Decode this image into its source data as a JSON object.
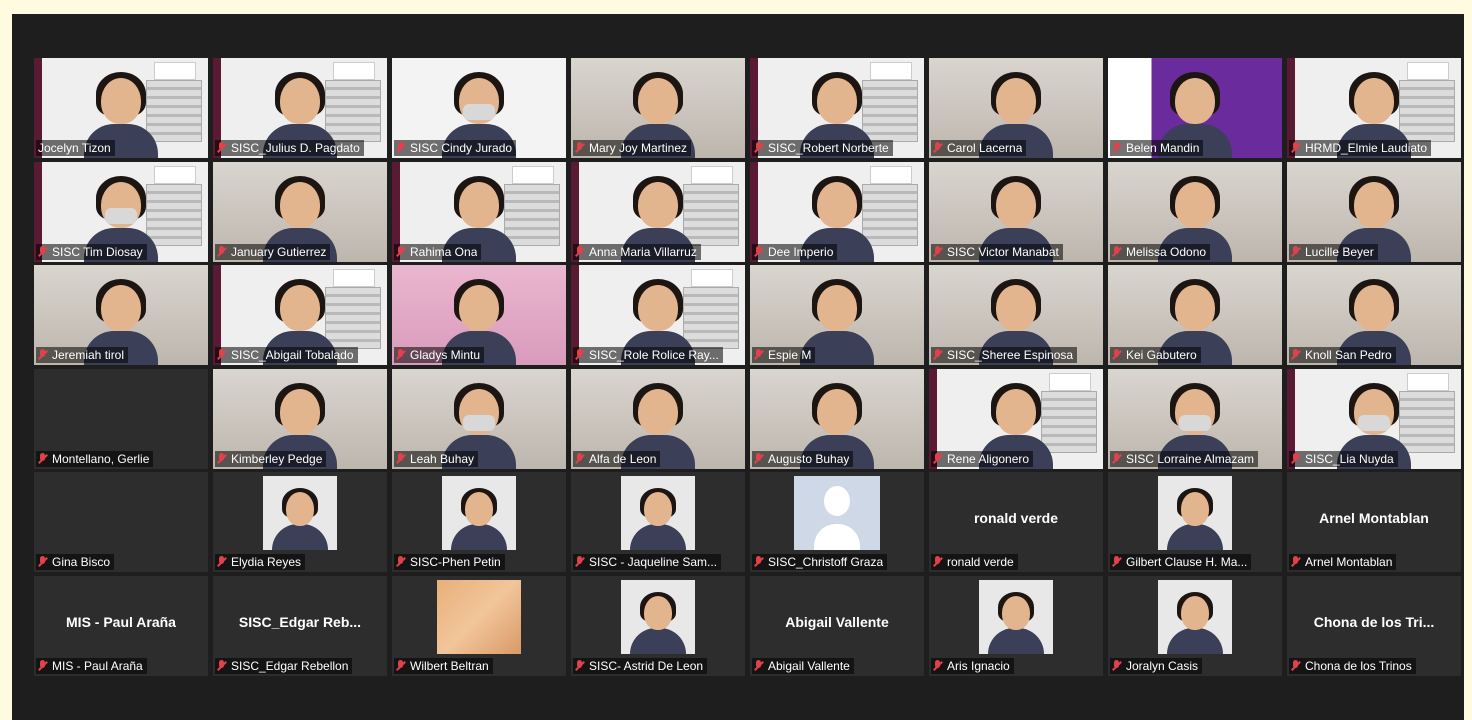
{
  "meeting": {
    "participants": [
      {
        "name": "Jocelyn Tizon",
        "muted": false,
        "bg": "branded",
        "view": "video"
      },
      {
        "name": "SISC_Julius D. Pagdato",
        "muted": true,
        "bg": "branded",
        "view": "video"
      },
      {
        "name": "SISC Cindy Jurado",
        "muted": true,
        "bg": "white",
        "view": "video",
        "mask": true
      },
      {
        "name": "Mary Joy Martinez",
        "muted": true,
        "bg": "office",
        "view": "video"
      },
      {
        "name": "SISC_Robert Norberte",
        "muted": true,
        "bg": "branded",
        "view": "video"
      },
      {
        "name": "Carol Lacerna",
        "muted": true,
        "bg": "office",
        "view": "video"
      },
      {
        "name": "Belen Mandin",
        "muted": true,
        "bg": "purple",
        "view": "video"
      },
      {
        "name": "HRMD_Elmie Laudiato",
        "muted": true,
        "bg": "branded",
        "view": "video"
      },
      {
        "name": "SISC Tim Diosay",
        "muted": true,
        "bg": "branded",
        "view": "video",
        "mask": true
      },
      {
        "name": "January Gutierrez",
        "muted": true,
        "bg": "office",
        "view": "video"
      },
      {
        "name": "Rahima Ona",
        "muted": true,
        "bg": "branded",
        "view": "video"
      },
      {
        "name": "Anna Maria Villarruz",
        "muted": true,
        "bg": "branded",
        "view": "video"
      },
      {
        "name": "Dee Imperio",
        "muted": true,
        "bg": "branded",
        "view": "video"
      },
      {
        "name": "SISC  Victor Manabat",
        "muted": true,
        "bg": "office",
        "view": "video"
      },
      {
        "name": "Melissa Odono",
        "muted": true,
        "bg": "office",
        "view": "video"
      },
      {
        "name": "Lucille Beyer",
        "muted": true,
        "bg": "office",
        "view": "video"
      },
      {
        "name": "Jeremiah tirol",
        "muted": true,
        "bg": "office",
        "view": "video"
      },
      {
        "name": "SISC_Abigail Tobalado",
        "muted": true,
        "bg": "branded",
        "view": "video"
      },
      {
        "name": "Gladys Mintu",
        "muted": true,
        "bg": "pink",
        "view": "video"
      },
      {
        "name": "SISC_Role Rolice Ray...",
        "muted": true,
        "bg": "branded",
        "view": "video"
      },
      {
        "name": "Espie M",
        "muted": true,
        "bg": "office",
        "view": "video"
      },
      {
        "name": "SISC_Sheree Espinosa",
        "muted": true,
        "bg": "office",
        "view": "video"
      },
      {
        "name": "Kei Gabutero",
        "muted": true,
        "bg": "office",
        "view": "video"
      },
      {
        "name": "Knoll San Pedro",
        "muted": true,
        "bg": "office",
        "view": "video"
      },
      {
        "name": "Montellano, Gerlie",
        "muted": true,
        "bg": "dark",
        "view": "off"
      },
      {
        "name": "Kimberley Pedge",
        "muted": true,
        "bg": "office",
        "view": "video"
      },
      {
        "name": "Leah Buhay",
        "muted": true,
        "bg": "office",
        "view": "video",
        "mask": true
      },
      {
        "name": "Alfa de Leon",
        "muted": true,
        "bg": "office",
        "view": "video"
      },
      {
        "name": "Augusto Buhay",
        "muted": true,
        "bg": "office",
        "view": "video"
      },
      {
        "name": "Rene Aligonero",
        "muted": true,
        "bg": "branded",
        "view": "video"
      },
      {
        "name": "SISC Lorraine Almazam",
        "muted": true,
        "bg": "office",
        "view": "video",
        "mask": true
      },
      {
        "name": "SISC_Lia Nuyda",
        "muted": true,
        "bg": "branded",
        "view": "video",
        "mask": true
      },
      {
        "name": "Gina Bisco",
        "muted": true,
        "bg": "dark",
        "view": "off"
      },
      {
        "name": "Elydia Reyes",
        "muted": true,
        "bg": "dark",
        "view": "photo"
      },
      {
        "name": "SISC-Phen Petin",
        "muted": true,
        "bg": "dark",
        "view": "photo"
      },
      {
        "name": "SISC - Jaqueline Sam...",
        "muted": true,
        "bg": "dark",
        "view": "photo"
      },
      {
        "name": "SISC_Christoff Graza",
        "muted": true,
        "bg": "dark",
        "view": "silhouette"
      },
      {
        "name": "ronald verde",
        "muted": true,
        "bg": "dark",
        "view": "text",
        "display": "ronald verde"
      },
      {
        "name": "Gilbert Clause H. Ma...",
        "muted": true,
        "bg": "dark",
        "view": "photo"
      },
      {
        "name": "Arnel Montablan",
        "muted": true,
        "bg": "dark",
        "view": "text",
        "display": "Arnel Montablan"
      },
      {
        "name": "MIS - Paul Araña",
        "muted": true,
        "bg": "dark",
        "view": "text",
        "display": "MIS - Paul Araña"
      },
      {
        "name": "SISC_Edgar Rebellon",
        "muted": true,
        "bg": "dark",
        "view": "text",
        "display": "SISC_Edgar  Reb..."
      },
      {
        "name": "Wilbert Beltran",
        "muted": true,
        "bg": "dark",
        "view": "blurred"
      },
      {
        "name": "SISC- Astrid De Leon",
        "muted": true,
        "bg": "dark",
        "view": "photo"
      },
      {
        "name": "Abigail Vallente",
        "muted": true,
        "bg": "dark",
        "view": "text",
        "display": "Abigail Vallente"
      },
      {
        "name": "Aris Ignacio",
        "muted": true,
        "bg": "dark",
        "view": "photo"
      },
      {
        "name": "Joralyn Casis",
        "muted": true,
        "bg": "dark",
        "view": "photo"
      },
      {
        "name": "Chona de los Trinos",
        "muted": true,
        "bg": "dark",
        "view": "text",
        "display": "Chona de los Tri..."
      }
    ]
  }
}
